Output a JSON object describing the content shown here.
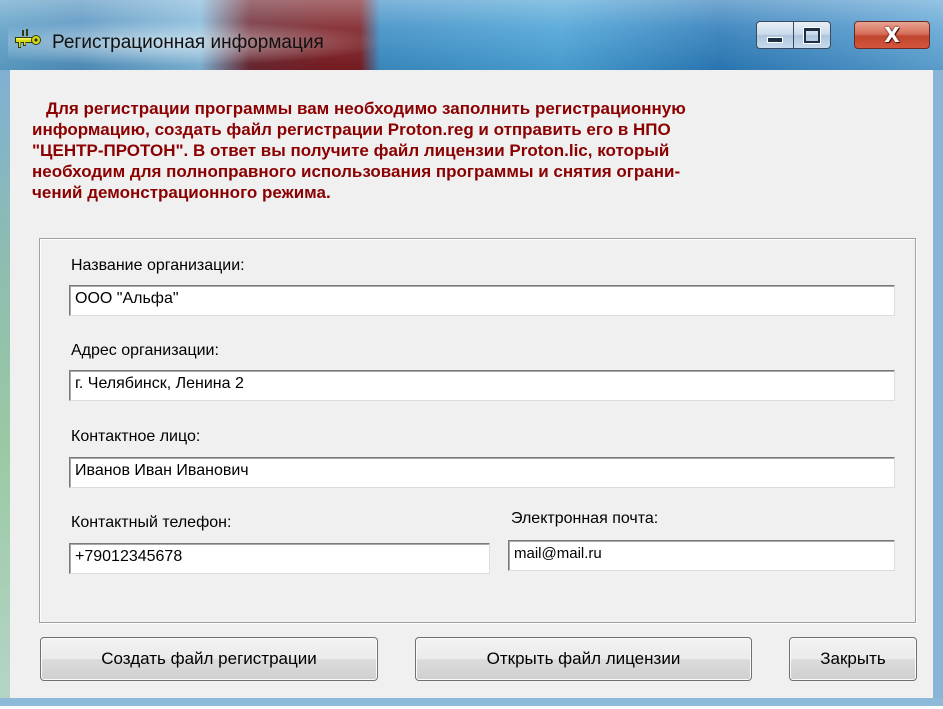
{
  "window": {
    "title": "Регистрационная информация",
    "icon": "key-icon",
    "controls": {
      "minimize": "minimize-icon",
      "maximize": "maximize-icon",
      "close": "close-icon",
      "close_glyph": "X"
    }
  },
  "intro": {
    "lines": [
      "Для регистрации программы вам необходимо заполнить регистрационную",
      "информацию, создать файл регистрации  Proton.reg  и отправить его в НПО",
      "\"ЦЕНТР-ПРОТОН\".  В ответ вы получите файл лицензии  Proton.lic, который",
      "необходим для полноправного использования программы и снятия ограни-",
      "чений демонстрационного режима."
    ],
    "color": "#8b0000"
  },
  "form": {
    "org_name": {
      "label": "Название организации:",
      "value": "ООО \"Альфа\""
    },
    "org_address": {
      "label": "Адрес организации:",
      "value": "г. Челябинск, Ленина 2"
    },
    "contact_person": {
      "label": "Контактное лицо:",
      "value": "Иванов Иван Иванович"
    },
    "phone": {
      "label": "Контактный телефон:",
      "value": "+79012345678"
    },
    "email": {
      "label": "Электронная почта:",
      "value": "mail@mail.ru"
    }
  },
  "buttons": {
    "create": "Создать файл регистрации",
    "open": "Открыть файл лицензии",
    "close": "Закрыть"
  }
}
